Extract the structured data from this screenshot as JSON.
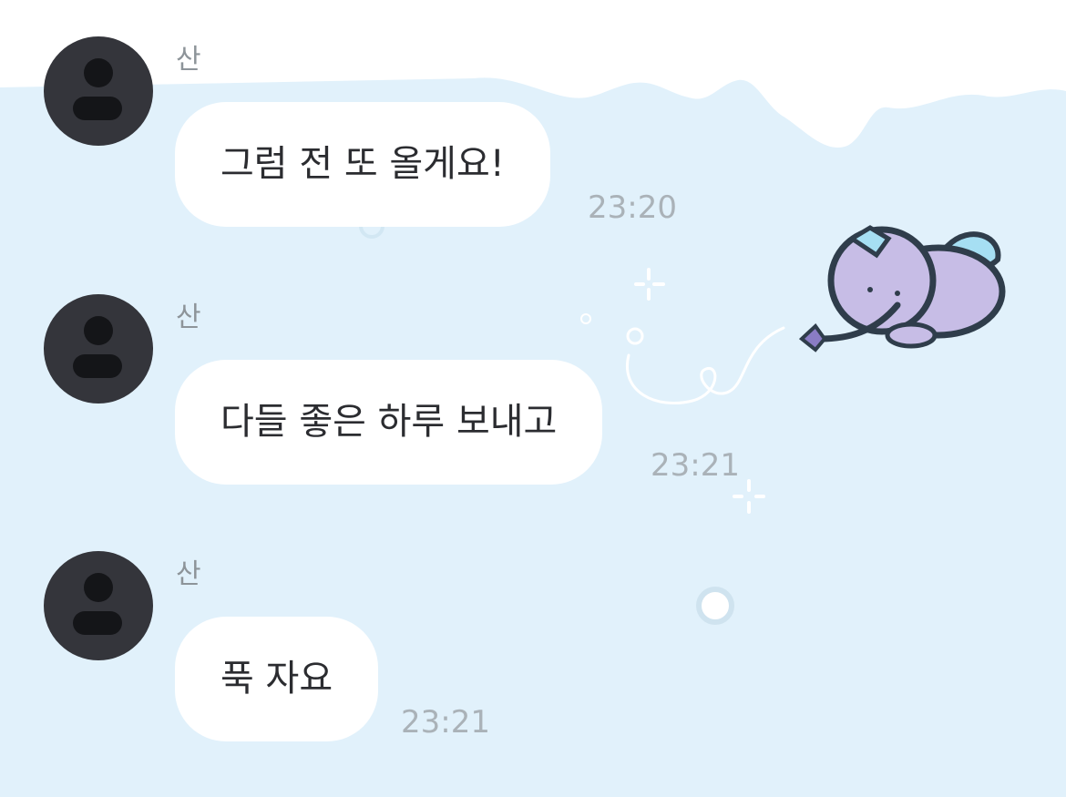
{
  "chat": {
    "messages": [
      {
        "sender": "산",
        "text": "그럼 전 또 올게요!",
        "time": "23:20"
      },
      {
        "sender": "산",
        "text": "다들 좋은 하루 보내고",
        "time": "23:21"
      },
      {
        "sender": "산",
        "text": "푹 자요",
        "time": "23:21"
      }
    ]
  },
  "theme": {
    "background": "#e1f1fb",
    "bubble": "#ffffff",
    "avatar": "#34353b",
    "text": "#2b2c30",
    "time": "#aab2b8"
  },
  "decorations": [
    "snow-cloud",
    "flying-cat-sticker",
    "doodle-sparkles"
  ]
}
